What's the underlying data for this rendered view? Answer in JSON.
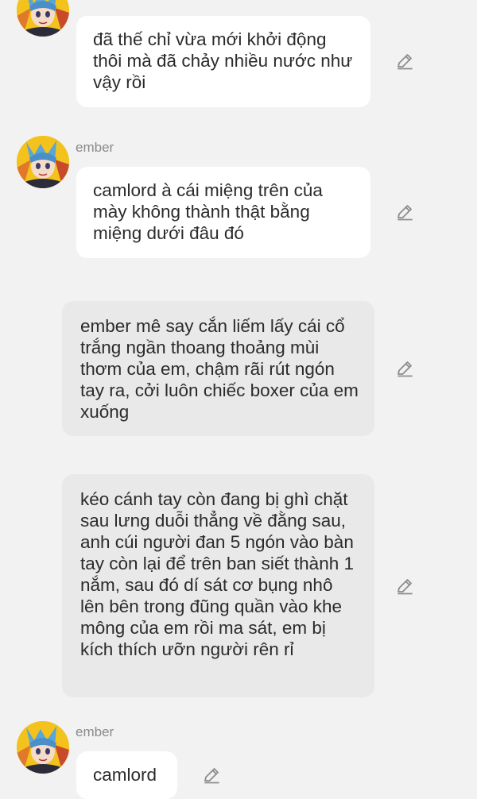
{
  "messages": [
    {
      "sender": "",
      "text": "đã thế chỉ vừa mới khởi động thôi mà đã chảy nhiều nước như vậy rồi"
    },
    {
      "sender": "ember",
      "text": "camlord à cái miệng trên của mày không thành thật bằng miệng dưới đâu đó"
    },
    {
      "sender": "",
      "text": "ember mê say cắn liếm lấy cái cổ trắng ngần thoang thoảng mùi thơm của em, chậm rãi rút ngón tay ra, cởi luôn chiếc boxer của em xuống"
    },
    {
      "sender": "",
      "text": "kéo cánh tay còn đang bị ghì chặt sau lưng duỗi thẳng về đằng sau, anh cúi người đan 5 ngón vào bàn tay còn lại để trên ban siết thành 1 nắm, sau đó  dí sát cơ bụng nhô lên bên trong đũng quần vào khe mông của em rồi ma sát, em bị kích thích ưỡn người rên rỉ"
    },
    {
      "sender": "ember",
      "text": "camlord"
    }
  ],
  "icons": {
    "edit": "pencil-edit-icon",
    "avatar": "anime-character-avatar"
  },
  "colors": {
    "background": "#f2f2f2",
    "bubble_other": "#ffffff",
    "bubble_own": "#e9e9e9",
    "text": "#2b2b2b",
    "username": "#8a8a8a",
    "icon": "#8c8c8c"
  }
}
